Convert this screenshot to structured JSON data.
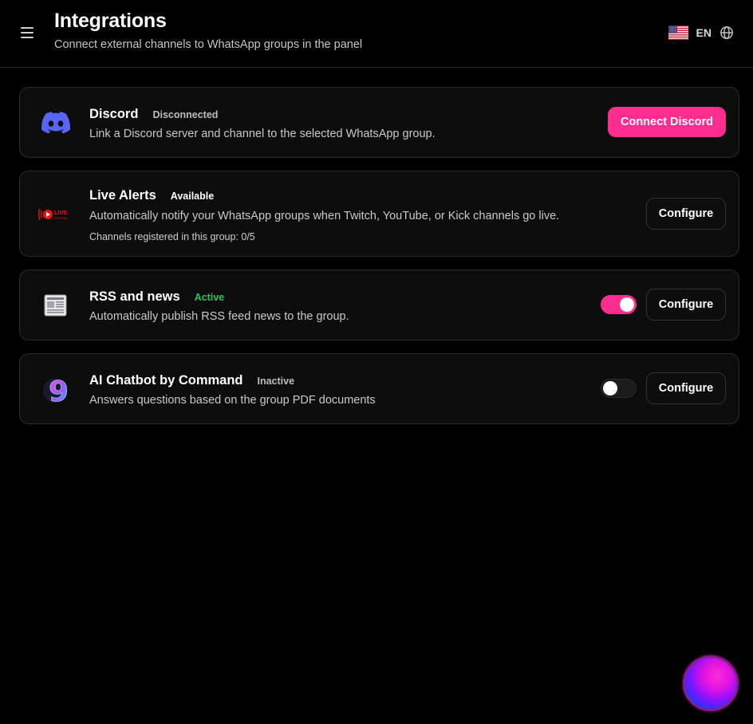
{
  "header": {
    "title": "Integrations",
    "subtitle": "Connect external channels to WhatsApp groups in the panel",
    "language_code": "EN",
    "flag_icon": "us-flag-icon",
    "globe_icon": "globe-icon",
    "menu_icon": "hamburger-menu-icon"
  },
  "integrations": [
    {
      "title": "Discord",
      "status": "Disconnected",
      "status_color": "#bdbdbd",
      "description": "Link a Discord server and channel to the selected WhatsApp group.",
      "icon": "discord-icon",
      "icon_color": "#5865f2",
      "action_label": "Connect Discord"
    },
    {
      "title": "Live Alerts",
      "status": "Available",
      "status_color": "#ffffff",
      "description": "Automatically notify your WhatsApp groups when Twitch, YouTube, or Kick channels go live.",
      "note": "Channels registered in this group: 0/5",
      "icon": "live-stream-icon",
      "icon_text": "LIVE",
      "icon_subtext": "STREAM",
      "action_label": "Configure"
    },
    {
      "title": "RSS and news",
      "status": "Active",
      "status_color": "#22c55e",
      "description": "Automatically publish RSS feed news to the group.",
      "icon": "newspaper-icon",
      "toggle_on": true,
      "action_label": "Configure"
    },
    {
      "title": "AI Chatbot by Command",
      "status": "Inactive",
      "status_color": "#bdbdbd",
      "description": "Answers questions based on the group PDF documents",
      "icon": "ai-chatbot-9-icon",
      "icon_glyph": "9",
      "toggle_on": false,
      "action_label": "Configure"
    }
  ],
  "fab": {
    "icon": "assistant-orb-icon"
  },
  "colors": {
    "accent": "#ff2d8f",
    "background": "#000000",
    "card": "#0d0d0d",
    "active": "#22c55e"
  }
}
